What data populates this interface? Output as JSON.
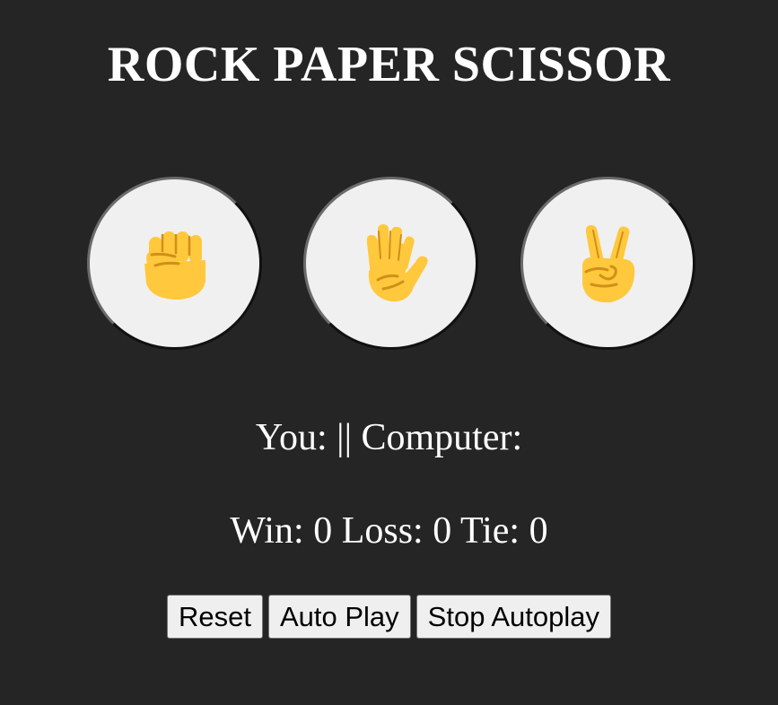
{
  "header": {
    "title": "ROCK PAPER SCISSOR"
  },
  "choices": [
    {
      "name": "rock",
      "icon": "raised-fist-icon"
    },
    {
      "name": "paper",
      "icon": "raised-hand-icon"
    },
    {
      "name": "scissors",
      "icon": "victory-hand-icon"
    }
  ],
  "result": {
    "text": "You: || Computer:"
  },
  "score": {
    "text": "Win: 0 Loss: 0 Tie: 0",
    "win": 0,
    "loss": 0,
    "tie": 0
  },
  "controls": {
    "reset_label": "Reset",
    "auto_play_label": "Auto Play",
    "stop_autoplay_label": "Stop Autoplay"
  },
  "colors": {
    "background": "#252525",
    "button_fill": "#f0f0f0",
    "emoji_yellow": "#FFC83D",
    "emoji_shade": "#D09018"
  }
}
